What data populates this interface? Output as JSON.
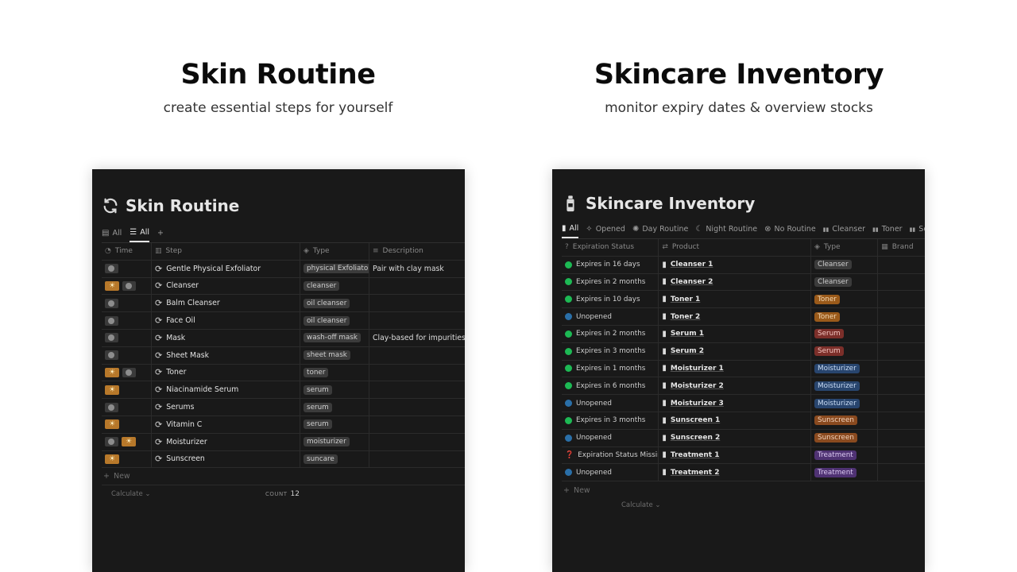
{
  "left_section": {
    "title": "Skin Routine",
    "subtitle": "create essential steps for yourself"
  },
  "right_section": {
    "title": "Skincare Inventory",
    "subtitle": "monitor expiry dates & overview stocks"
  },
  "routine": {
    "db_title": "Skin Routine",
    "views": [
      {
        "label": "All",
        "icon": "gallery-icon",
        "active": false
      },
      {
        "label": "All",
        "icon": "list-icon",
        "active": true
      }
    ],
    "add_view_glyph": "+",
    "columns": {
      "time": "Time",
      "step": "Step",
      "type": "Type",
      "description": "Description"
    },
    "rows": [
      {
        "time": [
          "night"
        ],
        "step": "Gentle Physical Exfoliator",
        "type": "physical Exfoliator",
        "description": "Pair with clay mask"
      },
      {
        "time": [
          "day",
          "night"
        ],
        "step": "Cleanser",
        "type": "cleanser",
        "description": ""
      },
      {
        "time": [
          "night"
        ],
        "step": "Balm Cleanser",
        "type": "oil cleanser",
        "description": ""
      },
      {
        "time": [
          "night"
        ],
        "step": "Face Oil",
        "type": "oil cleanser",
        "description": ""
      },
      {
        "time": [
          "night"
        ],
        "step": "Mask",
        "type": "wash-off mask",
        "description": "Clay-based for impurities"
      },
      {
        "time": [
          "night"
        ],
        "step": "Sheet Mask",
        "type": "sheet mask",
        "description": ""
      },
      {
        "time": [
          "day",
          "night"
        ],
        "step": "Toner",
        "type": "toner",
        "description": ""
      },
      {
        "time": [
          "day"
        ],
        "step": "Niacinamide Serum",
        "type": "serum",
        "description": ""
      },
      {
        "time": [
          "night"
        ],
        "step": "Serums",
        "type": "serum",
        "description": ""
      },
      {
        "time": [
          "day"
        ],
        "step": "Vitamin C",
        "type": "serum",
        "description": ""
      },
      {
        "time": [
          "night",
          "day"
        ],
        "step": "Moisturizer",
        "type": "moisturizer",
        "description": ""
      },
      {
        "time": [
          "day"
        ],
        "step": "Sunscreen",
        "type": "suncare",
        "description": ""
      }
    ],
    "new_label": "New",
    "calculate_label": "Calculate",
    "count_label": "COUNT",
    "count_value": "12"
  },
  "inventory": {
    "db_title": "Skincare Inventory",
    "views": [
      {
        "label": "All",
        "icon": "bottle-icon",
        "active": true
      },
      {
        "label": "Opened",
        "icon": "sparkle-icon",
        "active": false
      },
      {
        "label": "Day Routine",
        "icon": "sun-icon",
        "active": false
      },
      {
        "label": "Night Routine",
        "icon": "moon-icon",
        "active": false
      },
      {
        "label": "No Routine",
        "icon": "cross-circle-icon",
        "active": false
      },
      {
        "label": "Cleanser",
        "icon": "bottles-icon",
        "active": false
      },
      {
        "label": "Toner",
        "icon": "bottles-icon",
        "active": false
      },
      {
        "label": "Serum",
        "icon": "bottles-icon",
        "active": false
      }
    ],
    "columns": {
      "status": "Expiration Status",
      "product": "Product",
      "type": "Type",
      "brand": "Brand"
    },
    "rows": [
      {
        "status": "Expires in 16 days",
        "state": "green",
        "product": "Cleanser 1",
        "type": "Cleanser",
        "tag": "gray"
      },
      {
        "status": "Expires in 2 months",
        "state": "green",
        "product": "Cleanser 2",
        "type": "Cleanser",
        "tag": "gray"
      },
      {
        "status": "Expires in 10 days",
        "state": "green",
        "product": "Toner 1",
        "type": "Toner",
        "tag": "orange"
      },
      {
        "status": "Unopened",
        "state": "blue",
        "product": "Toner 2",
        "type": "Toner",
        "tag": "orange"
      },
      {
        "status": "Expires in 2 months",
        "state": "green",
        "product": "Serum 1",
        "type": "Serum",
        "tag": "red"
      },
      {
        "status": "Expires in 3 months",
        "state": "green",
        "product": "Serum 2",
        "type": "Serum",
        "tag": "red"
      },
      {
        "status": "Expires in 1 months",
        "state": "green",
        "product": "Moisturizer 1",
        "type": "Moisturizer",
        "tag": "blue"
      },
      {
        "status": "Expires in 6 months",
        "state": "green",
        "product": "Moisturizer 2",
        "type": "Moisturizer",
        "tag": "blue"
      },
      {
        "status": "Unopened",
        "state": "blue",
        "product": "Moisturizer 3",
        "type": "Moisturizer",
        "tag": "blue"
      },
      {
        "status": "Expires in 3 months",
        "state": "green",
        "product": "Sunscreen 1",
        "type": "Sunscreen",
        "tag": "brown"
      },
      {
        "status": "Unopened",
        "state": "blue",
        "product": "Sunscreen 2",
        "type": "Sunscreen",
        "tag": "brown"
      },
      {
        "status": "Expiration Status Missing",
        "state": "missing",
        "product": "Treatment 1",
        "type": "Treatment",
        "tag": "purple"
      },
      {
        "status": "Unopened",
        "state": "blue",
        "product": "Treatment 2",
        "type": "Treatment",
        "tag": "purple"
      }
    ],
    "new_label": "New",
    "calculate_label": "Calculate"
  },
  "colors": {
    "panel_bg": "#191919",
    "status_green": "#1db954",
    "status_blue": "#2a6fa8",
    "tag_gray": "#3b3b3b",
    "tag_orange": "#9a5a1a",
    "tag_red": "#7c2f2a",
    "tag_blue": "#28456e",
    "tag_brown": "#8a4a1f",
    "tag_purple": "#4f3273",
    "sun_badge": "#b7782a"
  }
}
